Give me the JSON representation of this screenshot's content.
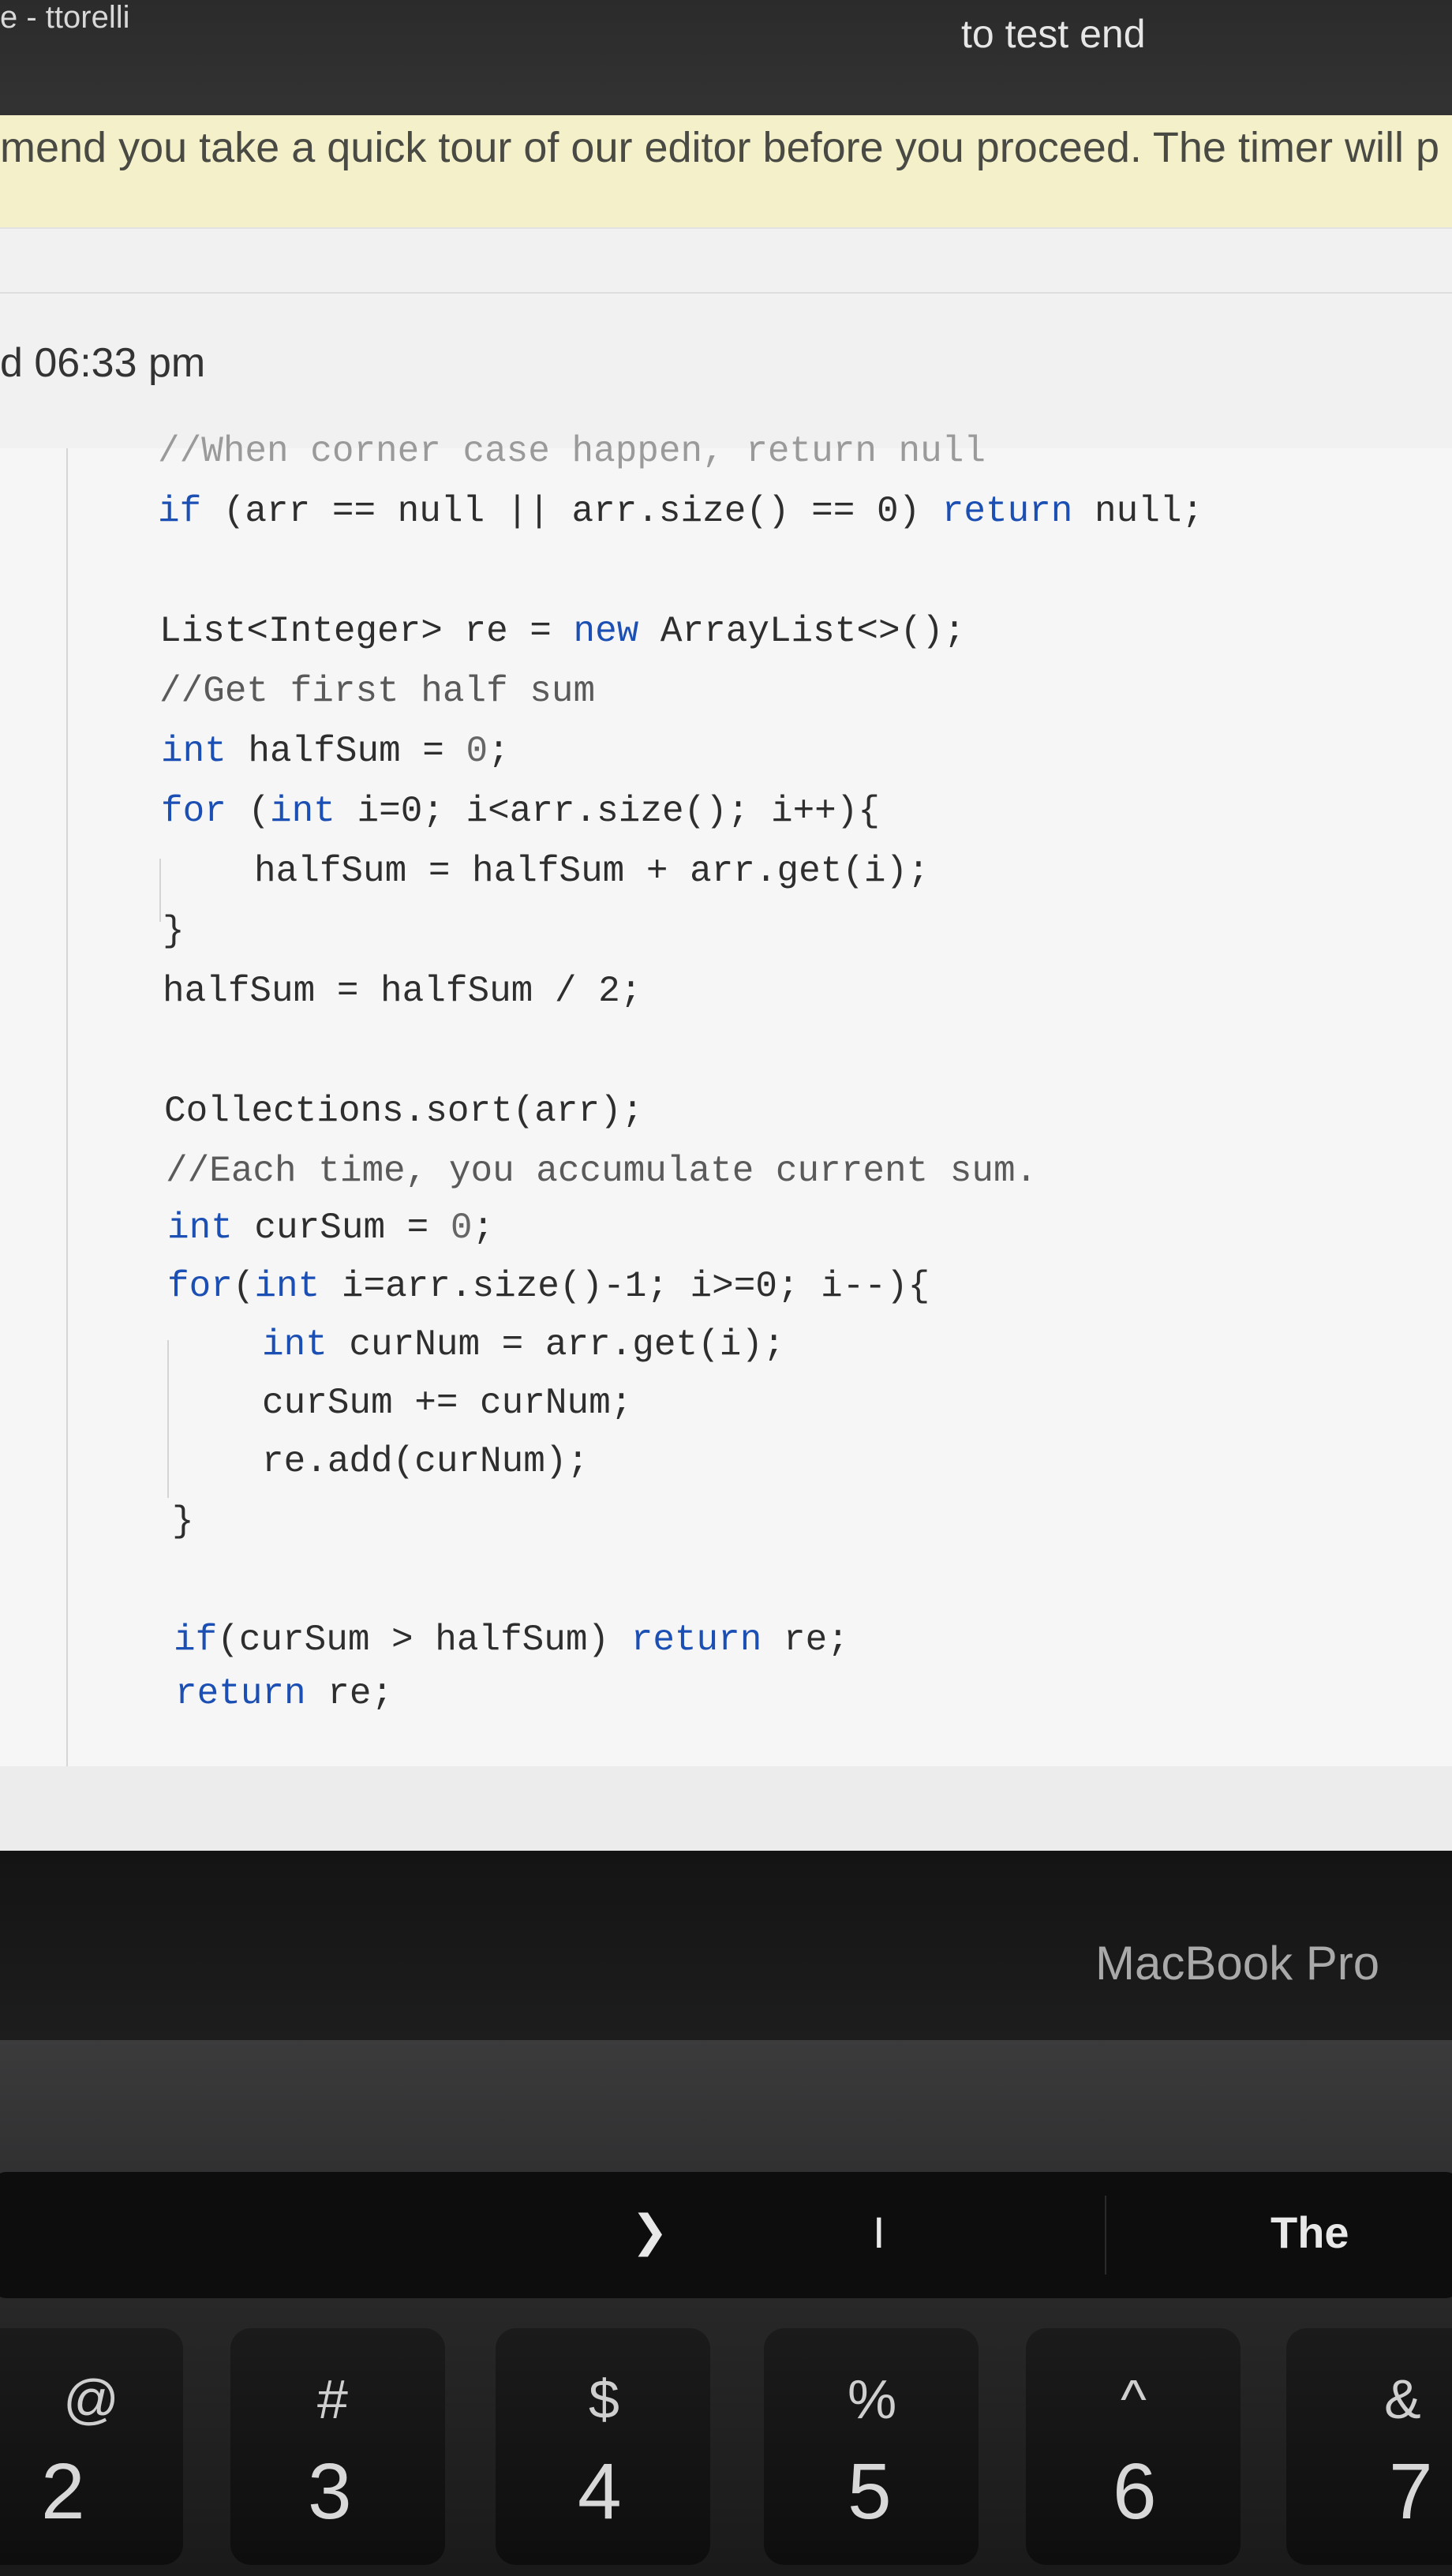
{
  "browser": {
    "window_title": "e - ttorelli",
    "test_end_label": "to test end",
    "banner_message": "mend you take a quick tour of our editor before you proceed. The timer will p",
    "time_label": "d 06:33 pm"
  },
  "editor": {
    "lines": [
      "//When corner case happen, return null",
      "if (arr == null || arr.size() == 0) return null;",
      "List<Integer> re = new ArrayList<>();",
      "//Get first half sum",
      "int halfSum = 0;",
      "for (int i=0; i<arr.size(); i++){",
      "halfSum = halfSum + arr.get(i);",
      "}",
      "halfSum = halfSum / 2;",
      "Collections.sort(arr);",
      "//Each time, you accumulate current sum.",
      "int curSum = 0;",
      "for(int i=arr.size()-1; i>=0; i--){",
      "int curNum = arr.get(i);",
      "curSum += curNum;",
      "re.add(curNum);",
      "}",
      "if(curSum > halfSum) return re;",
      "return re;"
    ]
  },
  "laptop": {
    "brand": "MacBook Pro",
    "touchbar": {
      "chevron": "❯",
      "suggestion_1": "I",
      "suggestion_2": "The"
    },
    "keys": [
      {
        "symbol": "@",
        "digit": "2"
      },
      {
        "symbol": "#",
        "digit": "3"
      },
      {
        "symbol": "$",
        "digit": "4"
      },
      {
        "symbol": "%",
        "digit": "5"
      },
      {
        "symbol": "^",
        "digit": "6"
      },
      {
        "symbol": "&",
        "digit": "7"
      }
    ]
  },
  "colors": {
    "keyword": "#1c4fb3",
    "banner_bg": "#f4f1ca",
    "top_bar": "#2f2f2f"
  }
}
